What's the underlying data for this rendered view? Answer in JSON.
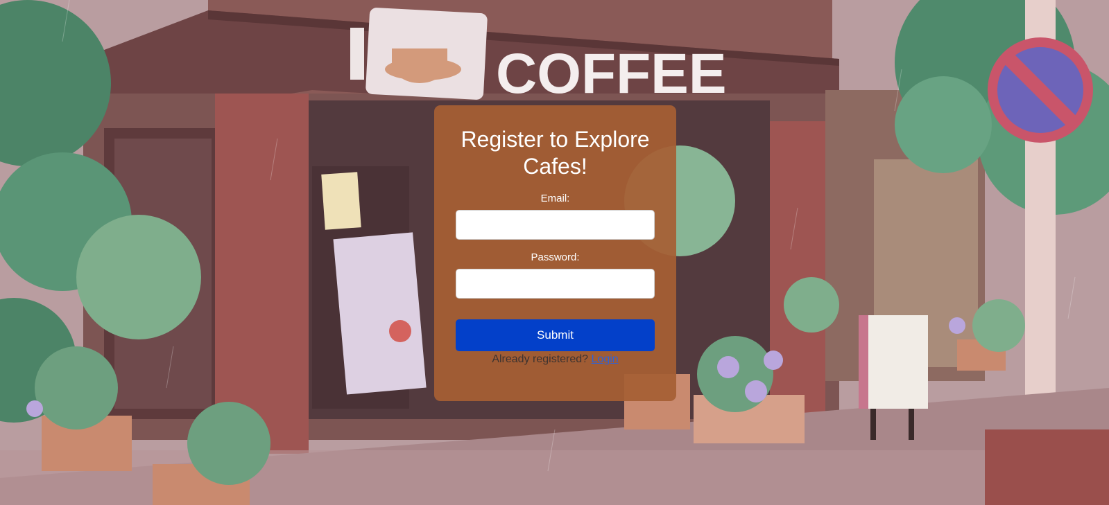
{
  "form": {
    "title": "Register to Explore Cafes!",
    "email_label": "Email:",
    "email_value": "",
    "password_label": "Password:",
    "password_value": "",
    "submit_label": "Submit",
    "already_text": "Already registered?",
    "login_link": "Login"
  },
  "background": {
    "sign_text": "COFFEE"
  },
  "colors": {
    "card": "#a65f34",
    "submit": "#0340c9",
    "link": "#2f61d6"
  }
}
